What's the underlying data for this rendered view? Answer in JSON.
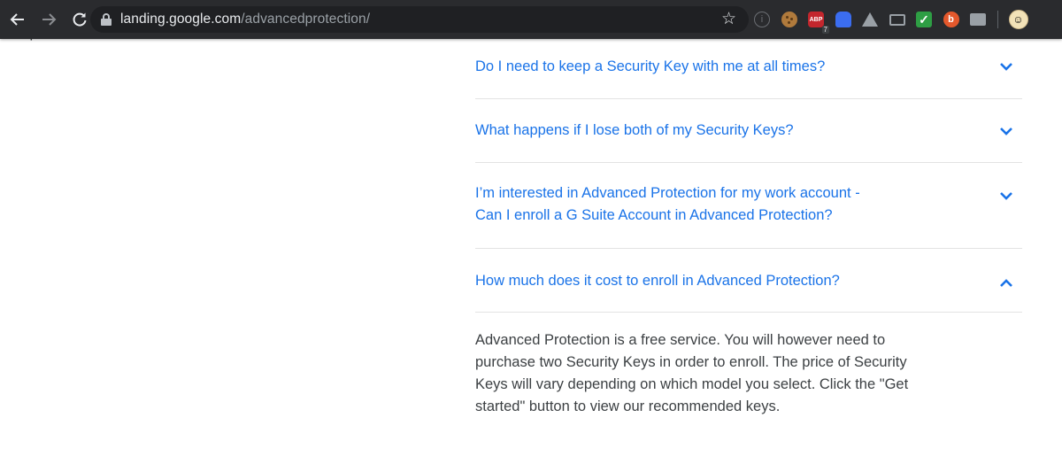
{
  "browser": {
    "url_host": "landing.google.com",
    "url_path": "/advancedprotection/",
    "adblock_badge": "7",
    "extensions": [
      "info-icon",
      "cookie-icon",
      "adblock-icon",
      "ghost-icon",
      "drive-icon",
      "cast-icon",
      "check-icon",
      "bitly-icon",
      "screenshot-icon"
    ]
  },
  "page": {
    "clipped_text": "questions and answers.",
    "faq": [
      {
        "question": "Do I need to keep a Security Key with me at all times?",
        "expanded": false
      },
      {
        "question": "What happens if I lose both of my Security Keys?",
        "expanded": false
      },
      {
        "question_line1": "I’m interested in Advanced Protection for my work account -",
        "question_line2": "Can I enroll a G Suite Account in Advanced Protection?",
        "expanded": false
      },
      {
        "question": "How much does it cost to enroll in Advanced Protection?",
        "expanded": true,
        "answer": "Advanced Protection is a free service. You will however need to purchase two Security Keys in order to enroll. The price of Security Keys will vary depending on which model you select. Click the \"Get started\" button to view our recommended keys."
      }
    ]
  },
  "colors": {
    "link": "#1a73e8",
    "text": "#3c4043",
    "toolbar": "#2a2b2e"
  }
}
